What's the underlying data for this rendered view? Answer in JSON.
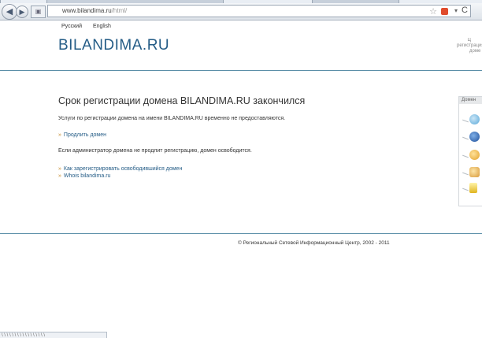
{
  "browser": {
    "url_host": "www.bilandima.ru",
    "url_path": "/html/",
    "back_icon": "back-arrow-icon",
    "forward_icon": "forward-arrow-icon",
    "star_icon": "☆",
    "reload_icon": "C",
    "dropdown_icon": "▾",
    "status_text": "\\ \\ \\ \\ \\ \\ \\ \\ \\ \\ \\ \\ \\ \\ \\ \\ \\"
  },
  "lang": {
    "ru": "Русский",
    "en": "English"
  },
  "logo": "BILANDIMA.RU",
  "corner_text": [
    "Ц",
    "регистрация",
    "доме"
  ],
  "content": {
    "headline": "Срок регистрации домена BILANDIMA.RU закончился",
    "para1": "Услуги по регистрации домена на имени BILANDIMA.RU временно не предоставляются.",
    "link_renew": "Продлить домен",
    "para2": "Если администратор домена не продлит регистрацию, домен освободится.",
    "link_register": "Как зарегистрировать освободившийся домен",
    "link_whois": "Whois bilandima.ru",
    "arrow": "»"
  },
  "side_panel": {
    "title": "Домен"
  },
  "footer": "© Региональный Сетевой Информационный Центр, 2002 - 2011",
  "colors": {
    "brand": "#245c86",
    "rule": "#5b8fa8",
    "arrow": "#c48a2a"
  }
}
